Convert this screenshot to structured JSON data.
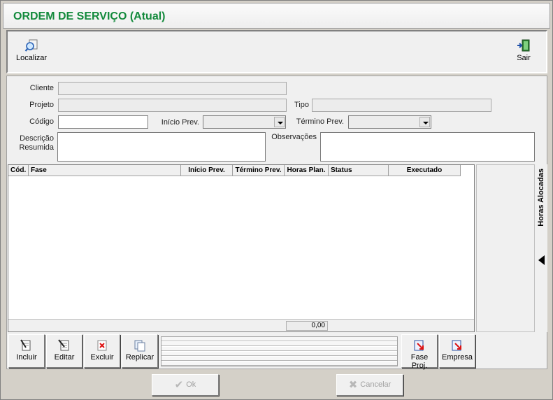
{
  "window": {
    "title": "ORDEM DE SERVIÇO (Atual)"
  },
  "toolbar": {
    "localizar_label": "Localizar",
    "sair_label": "Sair"
  },
  "form": {
    "cliente_label": "Cliente",
    "cliente_value": "",
    "projeto_label": "Projeto",
    "projeto_value": "",
    "tipo_label": "Tipo",
    "tipo_value": "",
    "codigo_label": "Código",
    "codigo_value": "",
    "inicio_prev_label": "Início Prev.",
    "inicio_prev_value": "",
    "termino_prev_label": "Término Prev.",
    "termino_prev_value": "",
    "descricao_label_line1": "Descrição",
    "descricao_label_line2": "Resumida",
    "descricao_value": "",
    "observacoes_label": "Observações",
    "observacoes_value": ""
  },
  "grid": {
    "columns": [
      "Cód.",
      "Fase",
      "Início Prev.",
      "Término Prev.",
      "Horas Plan.",
      "Status",
      "Executado"
    ],
    "rows": [],
    "total": "0,00"
  },
  "side_tab": {
    "label": "Horas Alocadas"
  },
  "actions": {
    "incluir": "Incluir",
    "editar": "Editar",
    "excluir": "Excluir",
    "replicar": "Replicar",
    "fase_proj": "Fase Proj.",
    "empresa": "Empresa"
  },
  "dialog": {
    "ok_label": "Ok",
    "cancel_label": "Cancelar"
  },
  "colors": {
    "title": "#138a3c",
    "window_bg": "#d4d0c8",
    "panel_bg": "#f0f0f0"
  },
  "icons": {
    "localizar": "magnifier-icon",
    "sair": "exit-door-icon",
    "incluir": "new-document-icon",
    "editar": "edit-document-icon",
    "excluir": "delete-icon",
    "replicar": "copy-icon",
    "fase_proj": "phase-document-icon",
    "empresa": "company-document-icon",
    "ok": "check-icon",
    "cancel": "x-icon"
  }
}
